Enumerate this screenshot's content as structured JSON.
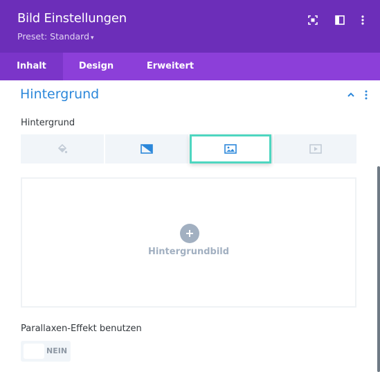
{
  "header": {
    "title": "Bild Einstellungen",
    "preset_label": "Preset: Standard",
    "icons": [
      "fullscreen-icon",
      "sidebar-layout-icon",
      "more-options-icon"
    ],
    "background_color": "#6c2eb9"
  },
  "tabs": [
    {
      "label": "Inhalt",
      "active": true
    },
    {
      "label": "Design",
      "active": false
    },
    {
      "label": "Erweitert",
      "active": false
    }
  ],
  "section": {
    "title": "Hintergrund",
    "expanded": true
  },
  "background": {
    "field_label": "Hintergrund",
    "types": [
      {
        "name": "color",
        "icon": "paint-bucket-icon",
        "selected": false
      },
      {
        "name": "gradient",
        "icon": "gradient-icon",
        "selected": false
      },
      {
        "name": "image",
        "icon": "image-icon",
        "selected": true
      },
      {
        "name": "video",
        "icon": "video-icon",
        "selected": false
      }
    ],
    "drop_label": "Hintergrundbild"
  },
  "parallax": {
    "label": "Parallaxen-Effekt benutzen",
    "toggle_text": "NEIN",
    "enabled": false
  },
  "colors": {
    "accent": "#2b87da",
    "selection_border": "#4ed6c0",
    "tab_bar": "#8c3fd9"
  }
}
